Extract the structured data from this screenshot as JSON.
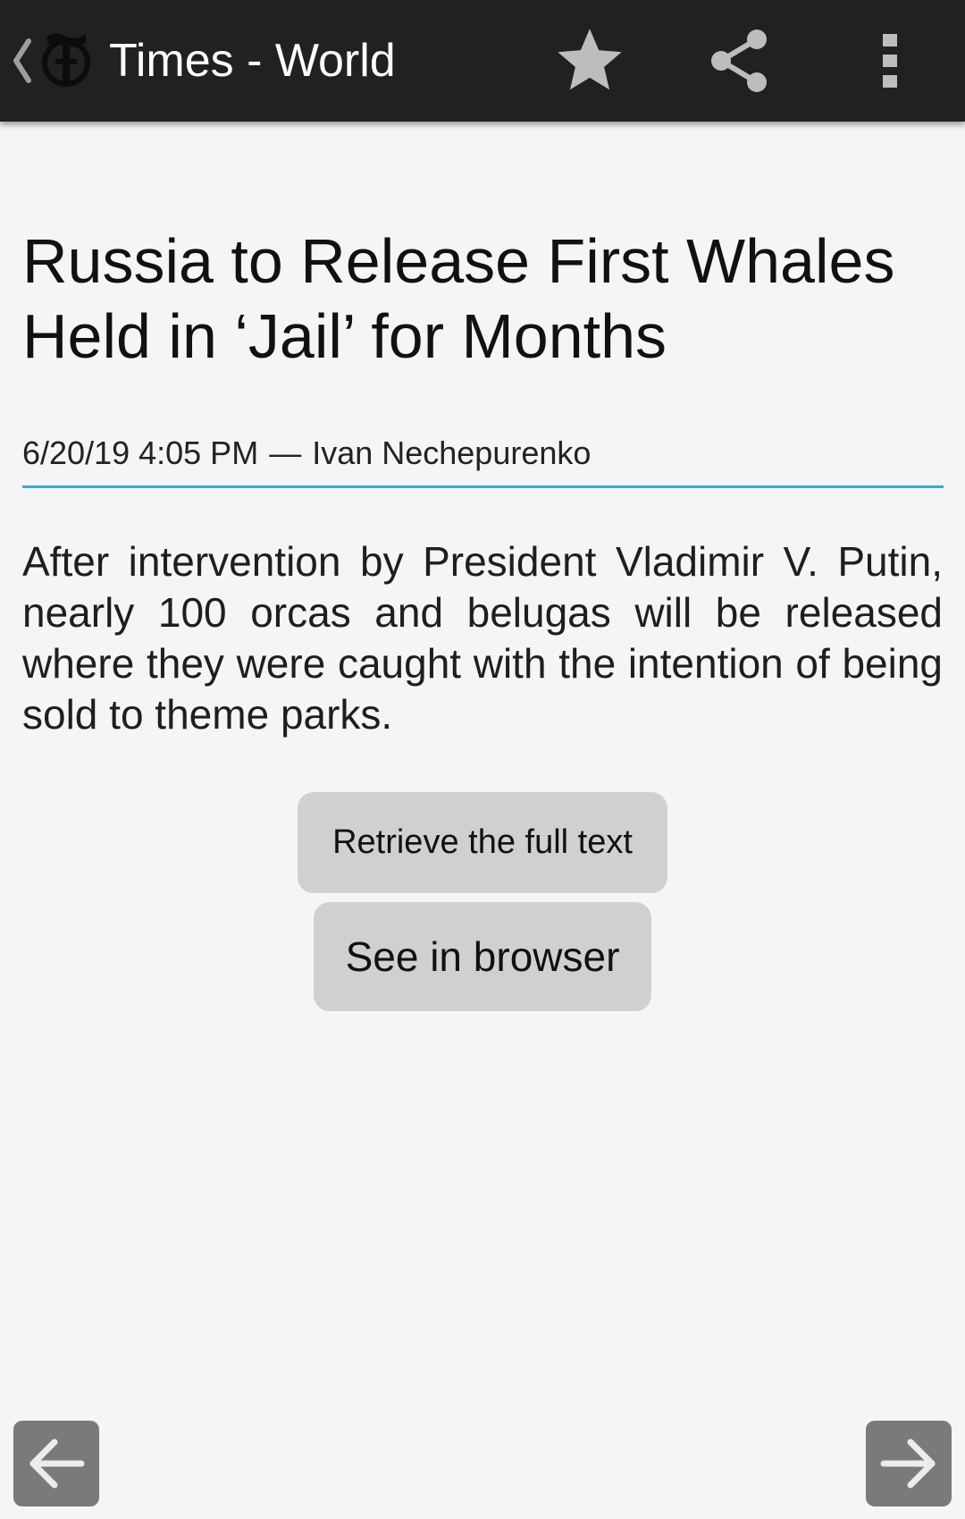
{
  "app_bar": {
    "title": "Times - World",
    "back_icon": "chevron-left-icon",
    "logo": "nyt-logo",
    "actions": [
      {
        "icon": "star-icon"
      },
      {
        "icon": "share-icon"
      },
      {
        "icon": "more-vertical-icon"
      }
    ]
  },
  "article": {
    "headline": "Russia to Release First Whales Held in ‘Jail’ for Months",
    "date": "6/20/19 4:05 PM",
    "separator": "—",
    "author": "Ivan Nechepurenko",
    "summary": "After intervention by President Vladimir V. Putin, nearly 100 orcas and belugas will be released where they were caught with the intention of being sold to theme parks."
  },
  "buttons": {
    "retrieve_full_text": "Retrieve the full text",
    "see_in_browser": "See in browser"
  },
  "navigation": {
    "previous_icon": "arrow-left-icon",
    "next_icon": "arrow-right-icon"
  },
  "colors": {
    "app_bar": "#212121",
    "background": "#f5f5f5",
    "accent_divider": "#3aa7d8",
    "button": "#d0d0d0",
    "nav_button": "#7a7a7a",
    "icon": "#bdbdbd"
  }
}
